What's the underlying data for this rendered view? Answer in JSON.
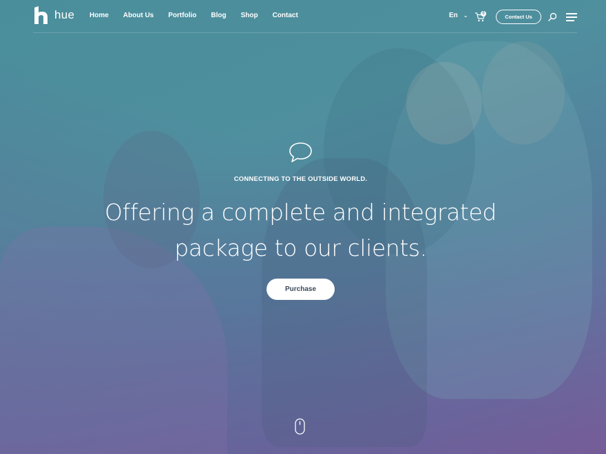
{
  "brand": {
    "name": "hue"
  },
  "nav": {
    "items": [
      {
        "label": "Home"
      },
      {
        "label": "About Us"
      },
      {
        "label": "Portfolio"
      },
      {
        "label": "Blog"
      },
      {
        "label": "Shop"
      },
      {
        "label": "Contact"
      }
    ],
    "language": "En",
    "cart_count": "0",
    "contact_button": "Contact Us"
  },
  "hero": {
    "kicker": "CONNECTING TO THE OUTSIDE WORLD.",
    "headline_line1": "Offering a complete and integrated",
    "headline_line2": "package to our clients.",
    "cta": "Purchase"
  },
  "icons": {
    "logo": "hue-logo-icon",
    "cart": "cart-icon",
    "search": "search-icon",
    "menu": "hamburger-icon",
    "chat": "speech-bubble-icon",
    "scroll": "mouse-scroll-icon"
  },
  "colors": {
    "overlay_top": "#4a8e9b",
    "overlay_bottom": "#7a5e99",
    "button_text": "#3c4a5a",
    "white": "#ffffff"
  }
}
